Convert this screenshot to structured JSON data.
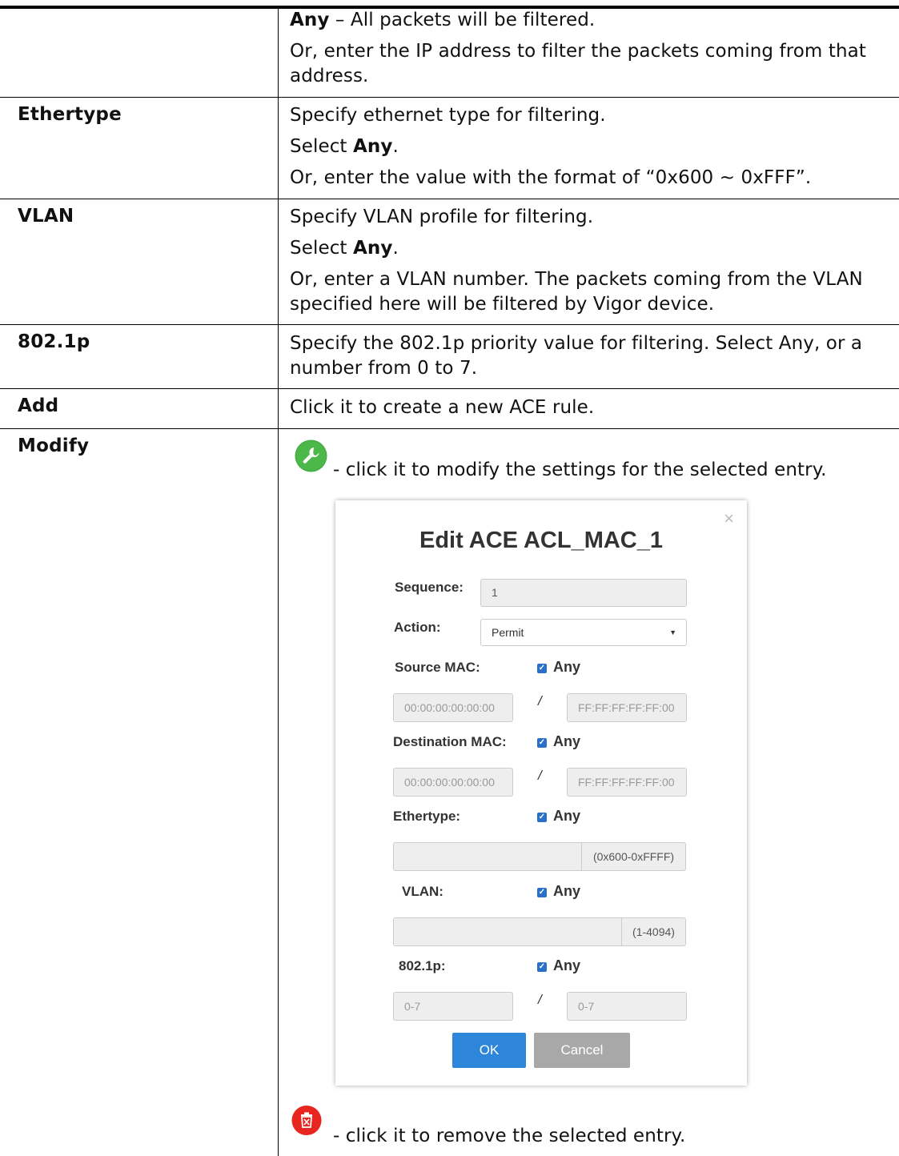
{
  "rows": {
    "source": {
      "line1_bold": "Any",
      "line1_rest": " – All packets will be filtered.",
      "line2": "Or, enter the IP address to filter the packets coming from that",
      "line3": "address."
    },
    "ethertype": {
      "label": "Ethertype",
      "line1": "Specify ethernet type for filtering.",
      "line2_pre": "Select ",
      "line2_bold": "Any",
      "line2_post": ".",
      "line3": "Or, enter the value with the format of “0x600 ~ 0xFFF”."
    },
    "vlan": {
      "label": "VLAN",
      "line1": "Specify VLAN profile for filtering.",
      "line2_pre": "Select ",
      "line2_bold": "Any",
      "line2_post": ".",
      "line3": "Or, enter a VLAN number. The packets coming from the VLAN",
      "line4": "specified here will be filtered by Vigor device."
    },
    "p8021": {
      "label": "802.1p",
      "line1": "Specify the 802.1p priority value for filtering. Select Any, or a",
      "line2": "number from 0 to 7."
    },
    "add": {
      "label": "Add",
      "line1": "Click it to create a new ACE rule."
    },
    "modify": {
      "label": "Modify",
      "modify_text": "- click it to modify the settings for the selected entry.",
      "remove_text": "- click it to remove the selected entry."
    }
  },
  "icons": {
    "modify": "wrench-icon",
    "remove": "trash-icon",
    "modify_color": "#3da43d",
    "remove_color": "#e8251f"
  },
  "dialog": {
    "title": "Edit ACE ACL_MAC_1",
    "close": "×",
    "sequence_label": "Sequence:",
    "sequence_value": "1",
    "action_label": "Action:",
    "action_value": "Permit",
    "source_mac_label": "Source MAC:",
    "destination_mac_label": "Destination MAC:",
    "ethertype_label": "Ethertype:",
    "vlan_label": "VLAN:",
    "p8021_label": "802.1p:",
    "any_label": "Any",
    "mac_placeholder": "00:00:00:00:00:00",
    "mask_placeholder": "FF:FF:FF:FF:FF:00",
    "ethertype_range": "(0x600-0xFFFF)",
    "vlan_range": "(1-4094)",
    "priority_placeholder": "0-7",
    "slash": "/",
    "ok": "OK",
    "cancel": "Cancel",
    "ok_color": "#2d86d9",
    "cancel_color": "#a8a8a8"
  }
}
